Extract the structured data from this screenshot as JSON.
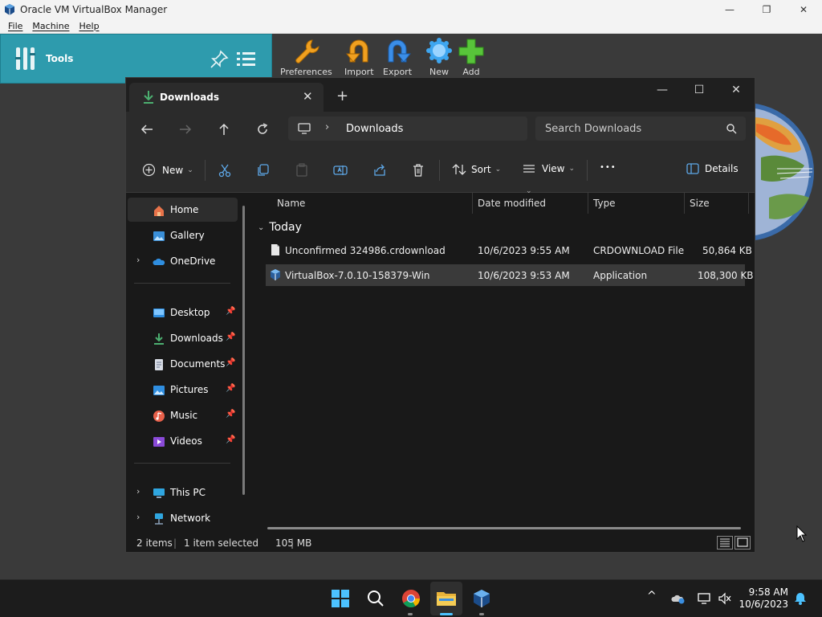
{
  "virtualbox": {
    "title": "Oracle VM VirtualBox Manager",
    "window_buttons": [
      "—",
      "❐",
      "✕"
    ],
    "menu": [
      "File",
      "Machine",
      "Help"
    ],
    "tools_label": "Tools",
    "toolbar": [
      {
        "label": "Preferences",
        "icon": "wrench-icon"
      },
      {
        "label": "Import",
        "icon": "import-icon"
      },
      {
        "label": "Export",
        "icon": "export-icon"
      },
      {
        "label": "New",
        "icon": "new-vm-icon"
      },
      {
        "label": "Add",
        "icon": "add-icon"
      }
    ]
  },
  "explorer": {
    "tab_label": "Downloads",
    "tab_close": "✕",
    "new_tab": "+",
    "window_buttons": [
      "—",
      "☐",
      "✕"
    ],
    "address": {
      "chevron": "›",
      "location": "Downloads"
    },
    "search_placeholder": "Search Downloads",
    "commands": {
      "new": "New",
      "sort": "Sort",
      "view": "View",
      "more": "•••",
      "details": "Details"
    },
    "nav": {
      "top": [
        {
          "label": "Home",
          "icon": "home-icon",
          "selected": true
        },
        {
          "label": "Gallery",
          "icon": "gallery-icon"
        },
        {
          "label": "OneDrive",
          "icon": "onedrive-icon",
          "expandable": true
        }
      ],
      "pinned": [
        {
          "label": "Desktop",
          "icon": "desktop-icon"
        },
        {
          "label": "Downloads",
          "icon": "downloads-icon"
        },
        {
          "label": "Documents",
          "icon": "documents-icon"
        },
        {
          "label": "Pictures",
          "icon": "pictures-icon"
        },
        {
          "label": "Music",
          "icon": "music-icon"
        },
        {
          "label": "Videos",
          "icon": "videos-icon"
        }
      ],
      "bottom": [
        {
          "label": "This PC",
          "icon": "this-pc-icon",
          "expandable": true
        },
        {
          "label": "Network",
          "icon": "network-icon",
          "expandable": true
        }
      ],
      "expand_glyph": "›",
      "pin_glyph": "📌"
    },
    "columns": [
      "Name",
      "Date modified",
      "Type",
      "Size"
    ],
    "group": "Today",
    "files": [
      {
        "name": "Unconfirmed 324986.crdownload",
        "date": "10/6/2023 9:55 AM",
        "type": "CRDOWNLOAD File",
        "size": "50,864 KB",
        "selected": false
      },
      {
        "name": "VirtualBox-7.0.10-158379-Win",
        "date": "10/6/2023 9:53 AM",
        "type": "Application",
        "size": "108,300 KB",
        "selected": true
      }
    ],
    "status": {
      "items": "2 items",
      "selected": "1 item selected",
      "size": "105 MB",
      "sep": "|"
    }
  },
  "taskbar": {
    "apps": [
      "start-icon",
      "search-icon",
      "chrome-icon",
      "file-explorer-icon",
      "virtualbox-icon"
    ],
    "tray_chevron": "^",
    "time": "9:58 AM",
    "date": "10/6/2023"
  },
  "colors": {
    "tools_bg": "#2e9bad",
    "explorer_bg": "#191919",
    "accent": "#4cc2ff"
  }
}
